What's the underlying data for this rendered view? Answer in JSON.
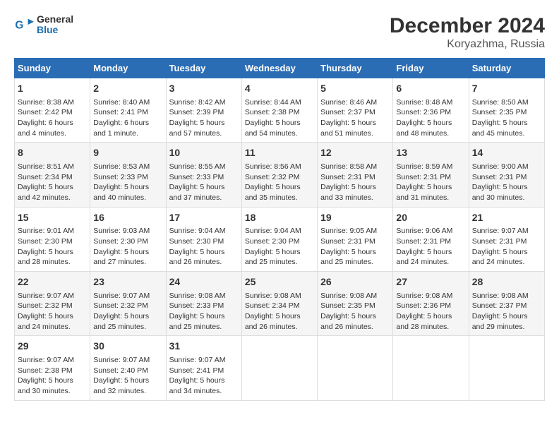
{
  "header": {
    "logo_line1": "General",
    "logo_line2": "Blue",
    "title": "December 2024",
    "subtitle": "Koryazhma, Russia"
  },
  "columns": [
    "Sunday",
    "Monday",
    "Tuesday",
    "Wednesday",
    "Thursday",
    "Friday",
    "Saturday"
  ],
  "weeks": [
    [
      {
        "day": "1",
        "info": "Sunrise: 8:38 AM\nSunset: 2:42 PM\nDaylight: 6 hours\nand 4 minutes."
      },
      {
        "day": "2",
        "info": "Sunrise: 8:40 AM\nSunset: 2:41 PM\nDaylight: 6 hours\nand 1 minute."
      },
      {
        "day": "3",
        "info": "Sunrise: 8:42 AM\nSunset: 2:39 PM\nDaylight: 5 hours\nand 57 minutes."
      },
      {
        "day": "4",
        "info": "Sunrise: 8:44 AM\nSunset: 2:38 PM\nDaylight: 5 hours\nand 54 minutes."
      },
      {
        "day": "5",
        "info": "Sunrise: 8:46 AM\nSunset: 2:37 PM\nDaylight: 5 hours\nand 51 minutes."
      },
      {
        "day": "6",
        "info": "Sunrise: 8:48 AM\nSunset: 2:36 PM\nDaylight: 5 hours\nand 48 minutes."
      },
      {
        "day": "7",
        "info": "Sunrise: 8:50 AM\nSunset: 2:35 PM\nDaylight: 5 hours\nand 45 minutes."
      }
    ],
    [
      {
        "day": "8",
        "info": "Sunrise: 8:51 AM\nSunset: 2:34 PM\nDaylight: 5 hours\nand 42 minutes."
      },
      {
        "day": "9",
        "info": "Sunrise: 8:53 AM\nSunset: 2:33 PM\nDaylight: 5 hours\nand 40 minutes."
      },
      {
        "day": "10",
        "info": "Sunrise: 8:55 AM\nSunset: 2:33 PM\nDaylight: 5 hours\nand 37 minutes."
      },
      {
        "day": "11",
        "info": "Sunrise: 8:56 AM\nSunset: 2:32 PM\nDaylight: 5 hours\nand 35 minutes."
      },
      {
        "day": "12",
        "info": "Sunrise: 8:58 AM\nSunset: 2:31 PM\nDaylight: 5 hours\nand 33 minutes."
      },
      {
        "day": "13",
        "info": "Sunrise: 8:59 AM\nSunset: 2:31 PM\nDaylight: 5 hours\nand 31 minutes."
      },
      {
        "day": "14",
        "info": "Sunrise: 9:00 AM\nSunset: 2:31 PM\nDaylight: 5 hours\nand 30 minutes."
      }
    ],
    [
      {
        "day": "15",
        "info": "Sunrise: 9:01 AM\nSunset: 2:30 PM\nDaylight: 5 hours\nand 28 minutes."
      },
      {
        "day": "16",
        "info": "Sunrise: 9:03 AM\nSunset: 2:30 PM\nDaylight: 5 hours\nand 27 minutes."
      },
      {
        "day": "17",
        "info": "Sunrise: 9:04 AM\nSunset: 2:30 PM\nDaylight: 5 hours\nand 26 minutes."
      },
      {
        "day": "18",
        "info": "Sunrise: 9:04 AM\nSunset: 2:30 PM\nDaylight: 5 hours\nand 25 minutes."
      },
      {
        "day": "19",
        "info": "Sunrise: 9:05 AM\nSunset: 2:31 PM\nDaylight: 5 hours\nand 25 minutes."
      },
      {
        "day": "20",
        "info": "Sunrise: 9:06 AM\nSunset: 2:31 PM\nDaylight: 5 hours\nand 24 minutes."
      },
      {
        "day": "21",
        "info": "Sunrise: 9:07 AM\nSunset: 2:31 PM\nDaylight: 5 hours\nand 24 minutes."
      }
    ],
    [
      {
        "day": "22",
        "info": "Sunrise: 9:07 AM\nSunset: 2:32 PM\nDaylight: 5 hours\nand 24 minutes."
      },
      {
        "day": "23",
        "info": "Sunrise: 9:07 AM\nSunset: 2:32 PM\nDaylight: 5 hours\nand 25 minutes."
      },
      {
        "day": "24",
        "info": "Sunrise: 9:08 AM\nSunset: 2:33 PM\nDaylight: 5 hours\nand 25 minutes."
      },
      {
        "day": "25",
        "info": "Sunrise: 9:08 AM\nSunset: 2:34 PM\nDaylight: 5 hours\nand 26 minutes."
      },
      {
        "day": "26",
        "info": "Sunrise: 9:08 AM\nSunset: 2:35 PM\nDaylight: 5 hours\nand 26 minutes."
      },
      {
        "day": "27",
        "info": "Sunrise: 9:08 AM\nSunset: 2:36 PM\nDaylight: 5 hours\nand 28 minutes."
      },
      {
        "day": "28",
        "info": "Sunrise: 9:08 AM\nSunset: 2:37 PM\nDaylight: 5 hours\nand 29 minutes."
      }
    ],
    [
      {
        "day": "29",
        "info": "Sunrise: 9:07 AM\nSunset: 2:38 PM\nDaylight: 5 hours\nand 30 minutes."
      },
      {
        "day": "30",
        "info": "Sunrise: 9:07 AM\nSunset: 2:40 PM\nDaylight: 5 hours\nand 32 minutes."
      },
      {
        "day": "31",
        "info": "Sunrise: 9:07 AM\nSunset: 2:41 PM\nDaylight: 5 hours\nand 34 minutes."
      },
      null,
      null,
      null,
      null
    ]
  ]
}
